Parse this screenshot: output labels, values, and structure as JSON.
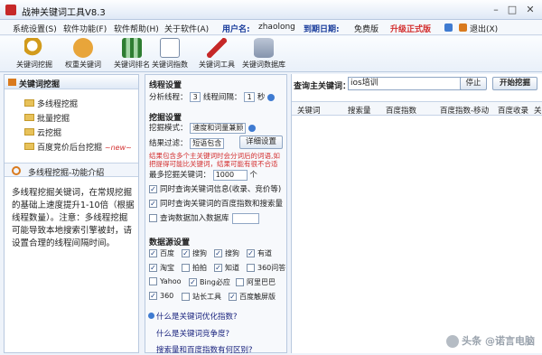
{
  "window": {
    "title": "战神关键词工具V8.3"
  },
  "menu": {
    "items": [
      "系统设置(S)",
      "软件功能(F)",
      "软件帮助(H)",
      "关于软件(A)"
    ],
    "user_label": "用户名:",
    "user_value": "zhaolong",
    "expire_label": "到期日期:",
    "expire_value": "免费版",
    "upgrade": "升级正式版",
    "exit": "退出(X)"
  },
  "toolbar": {
    "items": [
      "关键词挖掘",
      "权重关键词",
      "关键词排名",
      "关键词指数",
      "关键词工具",
      "关键词数据库"
    ]
  },
  "left": {
    "header": "关键词挖掘",
    "tree": [
      "多线程挖掘",
      "批量挖掘",
      "云挖掘",
      "百度竞价后台挖掘"
    ],
    "new_tag": "~new~",
    "intro_title": "多线程挖掘-功能介绍",
    "intro_text": "多线程挖掘关键词，在常规挖掘的基础上速度提升1-10倍（根据线程数量）。注意：多线程挖掘可能导致本地搜索引擎被封，请设置合理的线程间隔时间。"
  },
  "mid": {
    "thread_title": "线程设置",
    "thread_count_label": "分析线程：",
    "thread_count": "3",
    "thread_interval_label": "线程间隔：",
    "thread_interval": "1",
    "thread_interval_unit": "秒",
    "mining_title": "挖掘设置",
    "mode_label": "挖掘模式：",
    "mode_value": "速度和词量兼顾",
    "filter_label": "结果过滤：",
    "filter_value": "短语包含",
    "filter_button": "详细设置",
    "warning": "结果包含多个主关键词时会分词后的词语,如把提得可能比关键词，结果可能有很不合适",
    "min_label": "最多挖掘关键词：",
    "min_value": "1000",
    "min_unit": "个",
    "checks": [
      "同时查询关键词信息(收录、竞价等)",
      "同时查询关键词的百度指数和搜索量",
      "查询数据加入数据库"
    ],
    "source_title": "数据源设置",
    "sources": [
      "百度",
      "搜狗",
      "搜狗",
      "有道",
      "淘宝",
      "拍拍",
      "知道",
      "360问答",
      "Yahoo",
      "Bing必应",
      "阿里巴巴",
      "360",
      "站长工具",
      "百度触屏版"
    ],
    "questions": [
      "什么是关键词优化指数?",
      "什么是关键词竞争度?",
      "搜索量和百度指数有何区别?"
    ]
  },
  "right": {
    "query_label": "查询主关键词：",
    "query_value": "ios培训",
    "stop_button": "停止",
    "start_button": "开始挖掘",
    "columns": [
      "关键词",
      "搜索量",
      "百度指数",
      "百度指数-移动",
      "百度收录",
      "关"
    ]
  },
  "watermark": "头条 @诺言电脑"
}
